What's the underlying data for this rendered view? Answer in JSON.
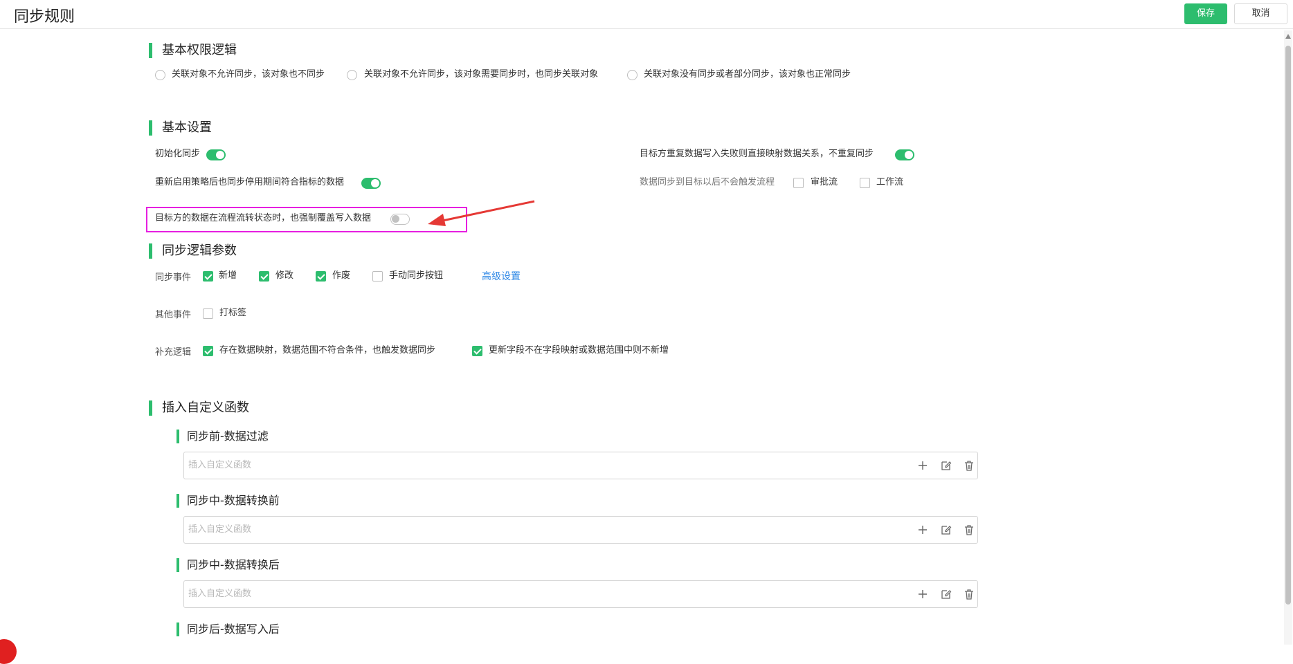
{
  "header": {
    "title": "同步规则",
    "save_label": "保存",
    "cancel_label": "取消"
  },
  "permission": {
    "title": "基本权限逻辑",
    "options": [
      "关联对象不允许同步，该对象也不同步",
      "关联对象不允许同步，该对象需要同步时，也同步关联对象",
      "关联对象没有同步或者部分同步，该对象也正常同步"
    ]
  },
  "basic": {
    "title": "基本设置",
    "init_sync": {
      "label": "初始化同步",
      "on": true
    },
    "resync_after_enable": {
      "label": "重新启用策略后也同步停用期间符合指标的数据",
      "on": true
    },
    "force_overwrite": {
      "label": "目标方的数据在流程流转状态时，也强制覆盖写入数据",
      "on": false
    },
    "duplicate_write": {
      "label": "目标方重复数据写入失败则直接映射数据关系，不重复同步",
      "on": true
    },
    "no_trigger_flow": {
      "label": "数据同步到目标以后不会触发流程",
      "approval": "审批流",
      "workflow": "工作流"
    }
  },
  "logic": {
    "title": "同步逻辑参数",
    "sync_events_label": "同步事件",
    "sync_events": [
      {
        "label": "新增",
        "checked": true
      },
      {
        "label": "修改",
        "checked": true
      },
      {
        "label": "作废",
        "checked": true
      },
      {
        "label": "手动同步按钮",
        "checked": false
      }
    ],
    "advanced_link": "高级设置",
    "other_events_label": "其他事件",
    "other_events": [
      {
        "label": "打标签",
        "checked": false
      }
    ],
    "supplement_label": "补充逻辑",
    "supplement": [
      {
        "label": "存在数据映射，数据范围不符合条件，也触发数据同步",
        "checked": true
      },
      {
        "label": "更新字段不在字段映射或数据范围中则不新增",
        "checked": true
      }
    ]
  },
  "custom_functions": {
    "title": "插入自定义函数",
    "placeholder": "插入自定义函数",
    "groups": [
      {
        "title": "同步前-数据过滤"
      },
      {
        "title": "同步中-数据转换前"
      },
      {
        "title": "同步中-数据转换后"
      },
      {
        "title": "同步后-数据写入后"
      }
    ]
  },
  "colors": {
    "accent": "#2dbd6e",
    "link": "#2f88e6",
    "highlight": "#e61fe0",
    "annotation_arrow": "#e53935"
  },
  "icons": [
    "plus-icon",
    "edit-icon",
    "trash-icon"
  ]
}
